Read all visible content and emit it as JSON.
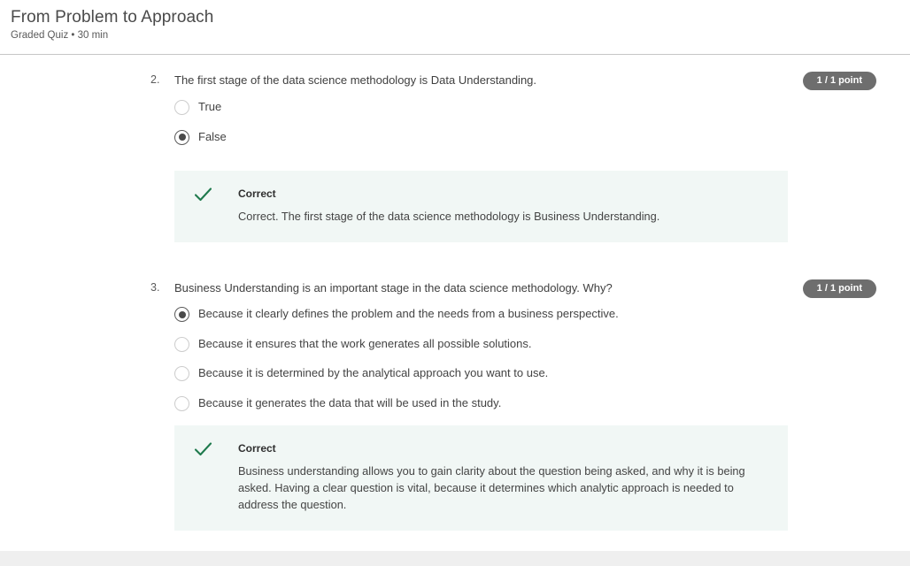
{
  "header": {
    "title": "From Problem to Approach",
    "subtitle": "Graded Quiz • 30 min"
  },
  "questions": [
    {
      "number": "2.",
      "prompt": "The first stage of the data science methodology is Data Understanding.",
      "points_badge": "1 / 1 point",
      "options": [
        {
          "label": "True",
          "selected": false
        },
        {
          "label": "False",
          "selected": true
        }
      ],
      "feedback": {
        "status": "Correct",
        "text": "Correct. The first stage of the data science methodology is Business Understanding."
      }
    },
    {
      "number": "3.",
      "prompt": "Business Understanding is an important stage in the data science methodology. Why?",
      "points_badge": "1 / 1 point",
      "options": [
        {
          "label": "Because it clearly defines the problem and the needs from a business perspective.",
          "selected": true
        },
        {
          "label": "Because it ensures that the work generates all possible  solutions.",
          "selected": false
        },
        {
          "label": "Because it is determined by the analytical approach you want to use.",
          "selected": false
        },
        {
          "label": "Because it generates the data that will be used in the study.",
          "selected": false
        }
      ],
      "feedback": {
        "status": "Correct",
        "text": "Business understanding allows you to gain clarity about the question being asked, and why it is being asked. Having a clear question is vital, because it determines which analytic approach is needed to address the question."
      }
    }
  ],
  "colors": {
    "feedback_background": "#f1f7f5",
    "check_green": "#1f7a4d",
    "badge_gray": "#6e6e6e"
  },
  "icons": {
    "check": "check-icon"
  }
}
